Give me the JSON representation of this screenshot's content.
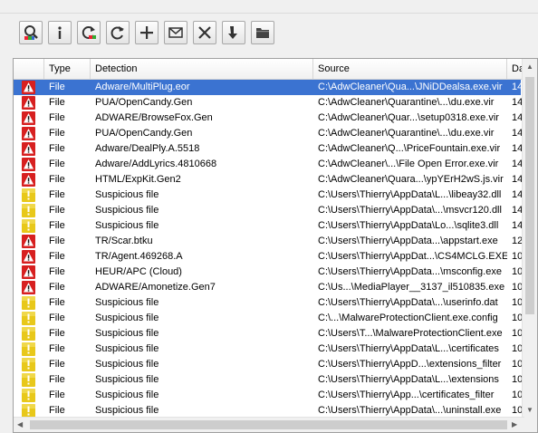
{
  "toolbar": {
    "buttons": [
      {
        "name": "scan-button",
        "icon": "magnifier-scan-icon"
      },
      {
        "name": "info-button",
        "icon": "info-icon"
      },
      {
        "name": "update-button",
        "icon": "update-refresh-icon"
      },
      {
        "name": "refresh-button",
        "icon": "refresh-icon"
      },
      {
        "name": "add-button",
        "icon": "plus-icon"
      },
      {
        "name": "email-button",
        "icon": "envelope-icon"
      },
      {
        "name": "delete-button",
        "icon": "close-x-icon"
      },
      {
        "name": "restore-button",
        "icon": "arrow-down-icon"
      },
      {
        "name": "folder-button",
        "icon": "folder-icon"
      }
    ]
  },
  "table": {
    "columns": {
      "type": "Type",
      "detection": "Detection",
      "source": "Source",
      "date": "Da"
    },
    "rows": [
      {
        "level": "threat",
        "type": "File",
        "detection": "Adware/MultiPlug.eor",
        "source": "C:\\AdwCleaner\\Qua...\\JNiDDealsa.exe.vir",
        "date": "14",
        "selected": true
      },
      {
        "level": "threat",
        "type": "File",
        "detection": "PUA/OpenCandy.Gen",
        "source": "C:\\AdwCleaner\\Quarantine\\...\\du.exe.vir",
        "date": "14"
      },
      {
        "level": "threat",
        "type": "File",
        "detection": "ADWARE/BrowseFox.Gen",
        "source": "C:\\AdwCleaner\\Quar...\\setup0318.exe.vir",
        "date": "14"
      },
      {
        "level": "threat",
        "type": "File",
        "detection": "PUA/OpenCandy.Gen",
        "source": "C:\\AdwCleaner\\Quarantine\\...\\du.exe.vir",
        "date": "14"
      },
      {
        "level": "threat",
        "type": "File",
        "detection": "Adware/DealPly.A.5518",
        "source": "C:\\AdwCleaner\\Q...\\PriceFountain.exe.vir",
        "date": "14"
      },
      {
        "level": "threat",
        "type": "File",
        "detection": "Adware/AddLyrics.4810668",
        "source": "C:\\AdwCleaner\\...\\File Open Error.exe.vir",
        "date": "14"
      },
      {
        "level": "threat",
        "type": "File",
        "detection": "HTML/ExpKit.Gen2",
        "source": "C:\\AdwCleaner\\Quara...\\ypYErH2wS.js.vir",
        "date": "14"
      },
      {
        "level": "warning",
        "type": "File",
        "detection": "Suspicious file",
        "source": "C:\\Users\\Thierry\\AppData\\L...\\libeay32.dll",
        "date": "14"
      },
      {
        "level": "warning",
        "type": "File",
        "detection": "Suspicious file",
        "source": "C:\\Users\\Thierry\\AppData\\...\\msvcr120.dll",
        "date": "14"
      },
      {
        "level": "warning",
        "type": "File",
        "detection": "Suspicious file",
        "source": "C:\\Users\\Thierry\\AppData\\Lo...\\sqlite3.dll",
        "date": "14"
      },
      {
        "level": "threat",
        "type": "File",
        "detection": "TR/Scar.btku",
        "source": "C:\\Users\\Thierry\\AppData...\\appstart.exe",
        "date": "12"
      },
      {
        "level": "threat",
        "type": "File",
        "detection": "TR/Agent.469268.A",
        "source": "C:\\Users\\Thierry\\AppDat...\\CS4MCLG.EXE",
        "date": "10"
      },
      {
        "level": "threat",
        "type": "File",
        "detection": "HEUR/APC (Cloud)",
        "source": "C:\\Users\\Thierry\\AppData...\\msconfig.exe",
        "date": "10"
      },
      {
        "level": "threat",
        "type": "File",
        "detection": "ADWARE/Amonetize.Gen7",
        "source": "C:\\Us...\\MediaPlayer__3137_il510835.exe",
        "date": "10"
      },
      {
        "level": "warning",
        "type": "File",
        "detection": "Suspicious file",
        "source": "C:\\Users\\Thierry\\AppData\\...\\userinfo.dat",
        "date": "10"
      },
      {
        "level": "warning",
        "type": "File",
        "detection": "Suspicious file",
        "source": "C:\\...\\MalwareProtectionClient.exe.config",
        "date": "10"
      },
      {
        "level": "warning",
        "type": "File",
        "detection": "Suspicious file",
        "source": "C:\\Users\\T...\\MalwareProtectionClient.exe",
        "date": "10"
      },
      {
        "level": "warning",
        "type": "File",
        "detection": "Suspicious file",
        "source": "C:\\Users\\Thierry\\AppData\\L...\\certificates",
        "date": "10"
      },
      {
        "level": "warning",
        "type": "File",
        "detection": "Suspicious file",
        "source": "C:\\Users\\Thierry\\AppD...\\extensions_filter",
        "date": "10"
      },
      {
        "level": "warning",
        "type": "File",
        "detection": "Suspicious file",
        "source": "C:\\Users\\Thierry\\AppData\\L...\\extensions",
        "date": "10"
      },
      {
        "level": "warning",
        "type": "File",
        "detection": "Suspicious file",
        "source": "C:\\Users\\Thierry\\App...\\certificates_filter",
        "date": "10"
      },
      {
        "level": "warning",
        "type": "File",
        "detection": "Suspicious file",
        "source": "C:\\Users\\Thierry\\AppData\\...\\uninstall.exe",
        "date": "10"
      }
    ]
  },
  "icons": {
    "threat": "red-warning-triangle-icon",
    "warning": "yellow-exclamation-icon"
  },
  "colors": {
    "selection": "#3b73d1",
    "threat": "#d72020",
    "warning": "#e8c81a"
  }
}
